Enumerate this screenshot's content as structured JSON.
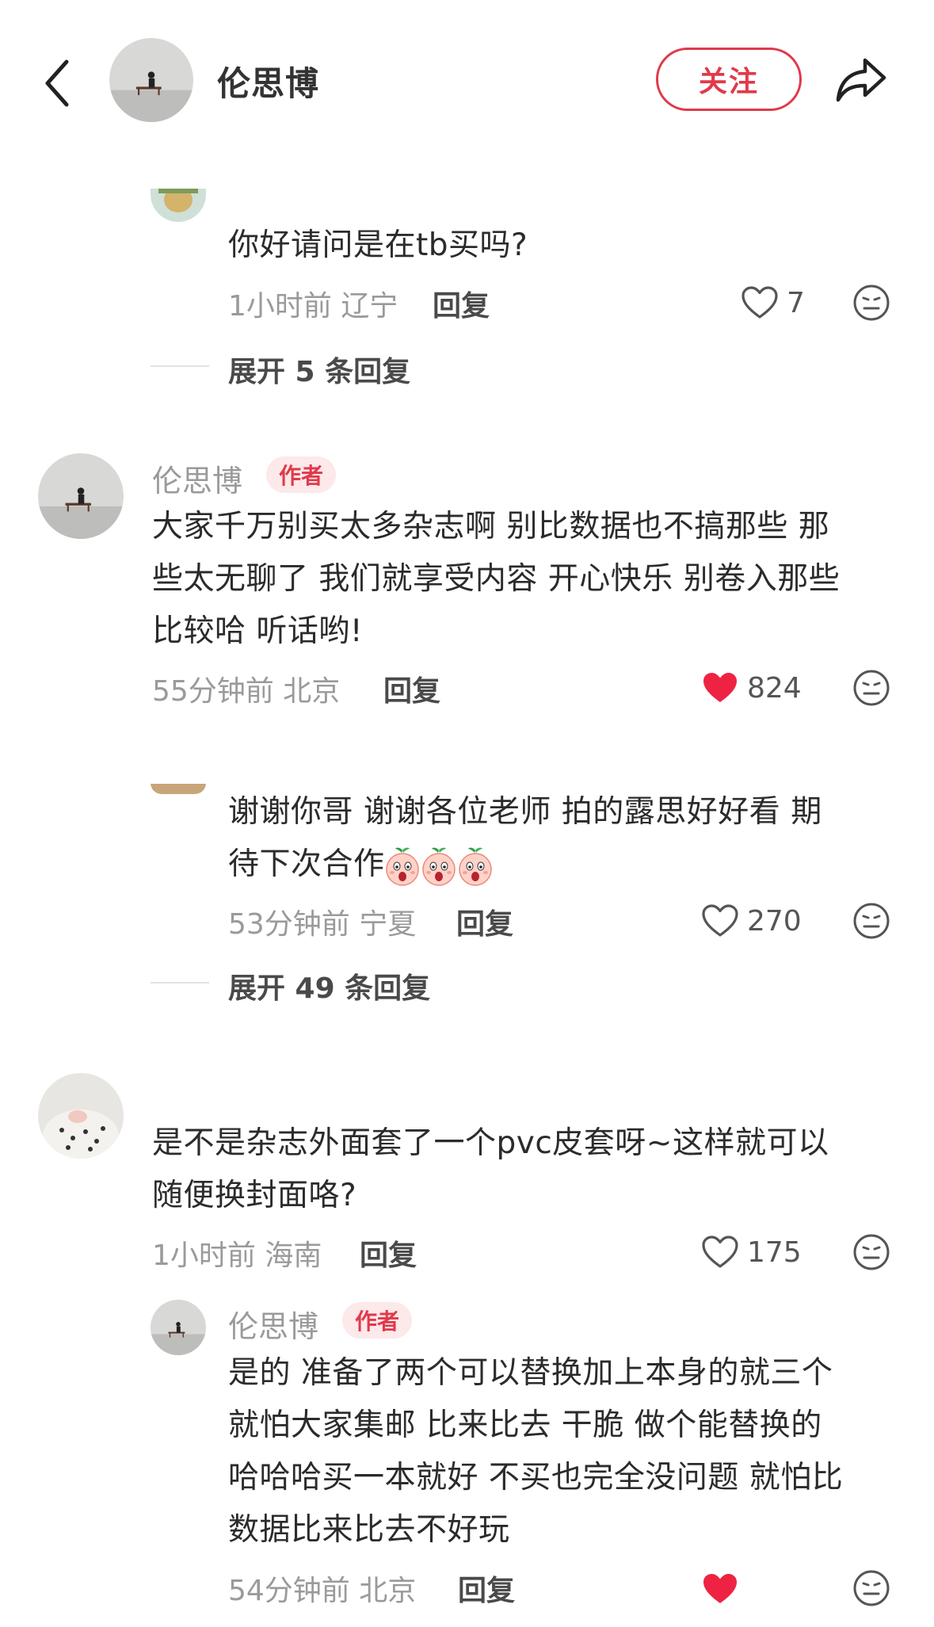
{
  "header": {
    "title": "伦思博",
    "follow_label": "关注"
  },
  "comments": [
    {
      "text": "你好请问是在tb买吗?",
      "time": "1小时前 辽宁",
      "reply": "回复",
      "likes": "7",
      "liked": false,
      "expand": "展开 5 条回复"
    },
    {
      "username": "伦思博",
      "badge": "作者",
      "lines": [
        "大家千万别买太多杂志啊 别比数据也不搞那些 那",
        "些太无聊了 我们就享受内容 开心快乐 别卷入那些",
        "比较哈 听话哟!"
      ],
      "time": "55分钟前 北京",
      "reply": "回复",
      "likes": "824",
      "liked": true
    },
    {
      "lines": [
        "谢谢你哥 谢谢各位老师 拍的露思好好看 期",
        "待下次合作"
      ],
      "time": "53分钟前 宁夏",
      "reply": "回复",
      "likes": "270",
      "liked": false,
      "expand": "展开 49 条回复"
    },
    {
      "lines": [
        "是不是杂志外面套了一个pvc皮套呀~这样就可以",
        "随便换封面咯?"
      ],
      "time": "1小时前 海南",
      "reply": "回复",
      "likes": "175",
      "liked": false
    },
    {
      "username": "伦思博",
      "badge": "作者",
      "lines": [
        "是的 准备了两个可以替换加上本身的就三个",
        "就怕大家集邮 比来比去 干脆 做个能替换的",
        "哈哈哈买一本就好 不买也完全没问题 就怕比",
        "数据比来比去不好玩"
      ],
      "time": "54分钟前 北京",
      "reply": "回复"
    }
  ],
  "colors": {
    "accent": "#e03a4b",
    "badge_bg": "#fde8ea",
    "muted": "#9a9a9a"
  }
}
